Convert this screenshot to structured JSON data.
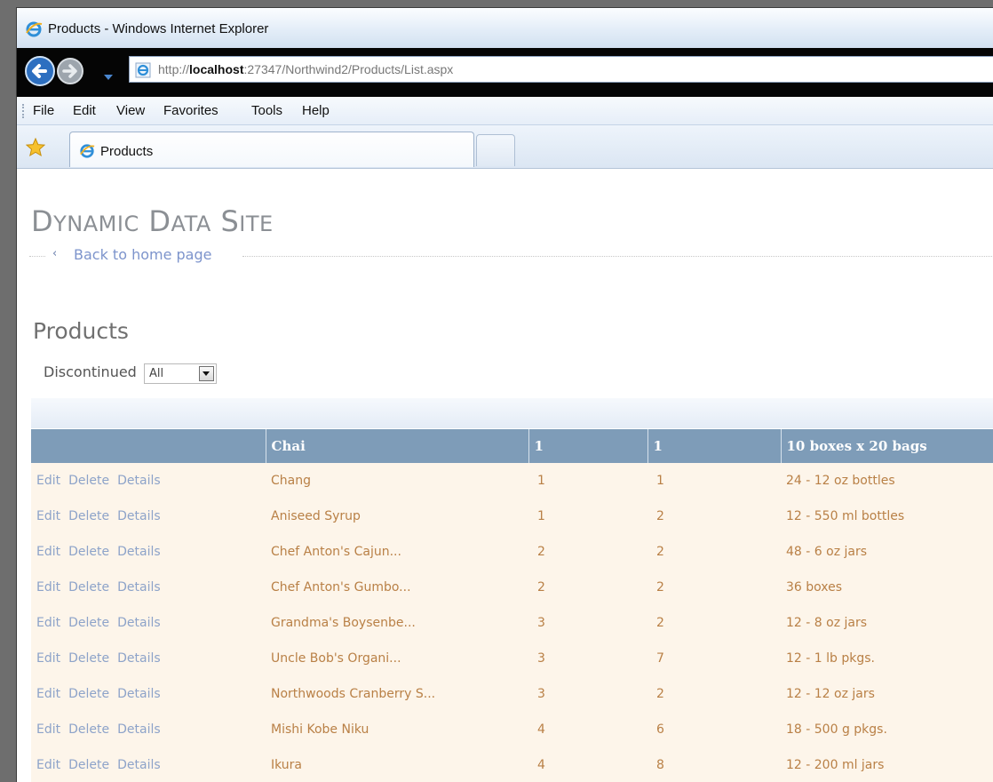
{
  "window": {
    "title": "Products - Windows Internet Explorer"
  },
  "address": {
    "url_prefix": "http://",
    "url_host": "localhost",
    "url_rest": ":27347/Northwind2/Products/List.aspx"
  },
  "menu": [
    "File",
    "Edit",
    "View",
    "Favorites",
    "Tools",
    "Help"
  ],
  "tabs": [
    {
      "label": "Products"
    }
  ],
  "site": {
    "title_first_cap": "D",
    "title_first_rest": "YNAMIC",
    "title_second_cap": "D",
    "title_second_rest": "ATA",
    "title_third_cap": "S",
    "title_third_rest": "ITE",
    "back_link": "Back to home page"
  },
  "page": {
    "heading": "Products"
  },
  "filter": {
    "label": "Discontinued",
    "selected": "All"
  },
  "grid": {
    "header": [
      "",
      "Chai",
      "1",
      "1",
      "10 boxes x 20 bags"
    ],
    "actions": [
      "Edit",
      "Delete",
      "Details"
    ],
    "rows": [
      [
        "Chang",
        "1",
        "1",
        "24 - 12 oz bottles"
      ],
      [
        "Aniseed Syrup",
        "1",
        "2",
        "12 - 550 ml bottles"
      ],
      [
        "Chef Anton's Cajun...",
        "2",
        "2",
        "48 - 6 oz jars"
      ],
      [
        "Chef Anton's Gumbo...",
        "2",
        "2",
        "36 boxes"
      ],
      [
        "Grandma's Boysenbe...",
        "3",
        "2",
        "12 - 8 oz jars"
      ],
      [
        "Uncle Bob's Organi...",
        "3",
        "7",
        "12 - 1 lb pkgs."
      ],
      [
        "Northwoods Cranberry S...",
        "3",
        "2",
        "12 - 12 oz jars"
      ],
      [
        "Mishi Kobe Niku",
        "4",
        "6",
        "18 - 500 g pkgs."
      ],
      [
        "Ikura",
        "4",
        "8",
        "12 - 200 ml jars"
      ]
    ]
  },
  "icons": {
    "browser": "ie-logo-icon",
    "back": "back-arrow-icon",
    "forward": "forward-arrow-icon",
    "favorites": "star-icon",
    "page": "page-ie-icon"
  },
  "colors": {
    "header_bg": "#7e9cb8",
    "row_bg": "#fdf5ea",
    "cell_text": "#b98046",
    "link": "#8da3c9"
  }
}
